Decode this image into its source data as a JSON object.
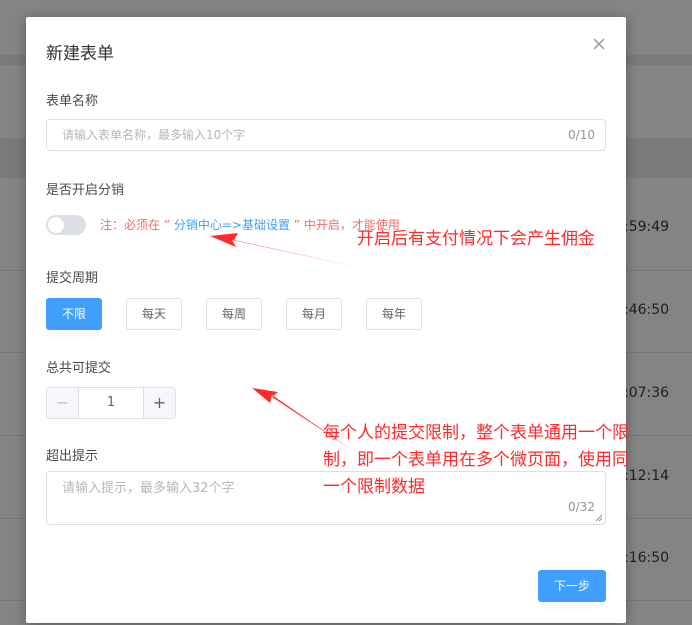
{
  "background": {
    "times": [
      ":59:49",
      ":46:50",
      ":07:36",
      ":12:14",
      ":16:50"
    ]
  },
  "dialog": {
    "title": "新建表单",
    "close_icon": "close-icon",
    "form_name": {
      "label": "表单名称",
      "placeholder": "请输入表单名称，最多输入10个字",
      "value": "",
      "counter": "0/10"
    },
    "distribution": {
      "label": "是否开启分销",
      "enabled": false,
      "note_prefix": "注：必须在 ”",
      "note_link": " 分销中心=>基础设置 ",
      "note_suffix": "” 中开启，才能使用"
    },
    "period": {
      "label": "提交周期",
      "options": [
        "不限",
        "每天",
        "每周",
        "每月",
        "每年"
      ],
      "selected": "不限"
    },
    "total": {
      "label": "总共可提交",
      "value": "1",
      "minus": "−",
      "plus": "+"
    },
    "overflow_tip": {
      "label": "超出提示",
      "placeholder": "请输入提示，最多输入32个字",
      "value": "",
      "counter": "0/32"
    },
    "next_label": "下一步"
  },
  "annotations": {
    "distribution_note": "开启后有支付情况下会产生佣金",
    "limit_note_lines": [
      "每个人的提交限制，整个表单通用一个限",
      "制，即一个表单用在多个微页面，使用同",
      "一个限制数据"
    ],
    "color": "#ff2a2a"
  },
  "colors": {
    "primary": "#409eff",
    "danger": "#f56c6c"
  }
}
